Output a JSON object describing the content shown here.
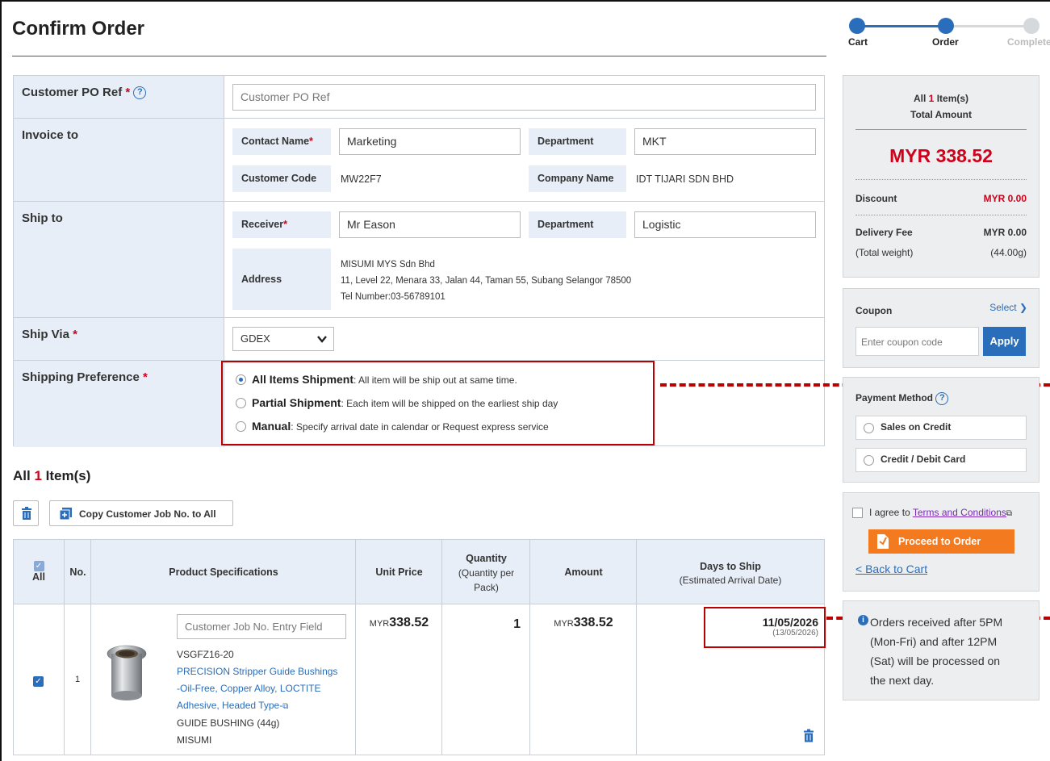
{
  "page": {
    "title": "Confirm Order"
  },
  "steps": [
    {
      "label": "Cart",
      "state": "done"
    },
    {
      "label": "Order",
      "state": "current"
    },
    {
      "label": "Complete",
      "state": "pending"
    }
  ],
  "customer_po": {
    "label": "Customer PO Ref",
    "placeholder": "Customer PO Ref"
  },
  "invoice": {
    "label": "Invoice to",
    "contact_name_label": "Contact Name",
    "contact_name_value": "Marketing",
    "department_label": "Department",
    "department_value": "MKT",
    "customer_code_label": "Customer Code",
    "customer_code_value": "MW22F7",
    "company_name_label": "Company Name",
    "company_name_value": "IDT TIJARI SDN BHD"
  },
  "ship_to": {
    "label": "Ship to",
    "receiver_label": "Receiver",
    "receiver_value": "Mr Eason",
    "department_label": "Department",
    "department_value": "Logistic",
    "address_label": "Address",
    "address_line1": "MISUMI MYS Sdn Bhd",
    "address_line2": "11, Level 22, Menara 33, Jalan 44, Taman 55, Subang Selangor   78500",
    "address_line3": "Tel Number:03-56789101"
  },
  "ship_via": {
    "label": "Ship Via",
    "selected": "GDEX"
  },
  "shipping_preference": {
    "label": "Shipping Preference",
    "options": [
      {
        "title": "All Items Shipment",
        "desc": ": All item will be ship out at same time.",
        "selected": true
      },
      {
        "title": "Partial Shipment",
        "desc": ": Each item will be shipped on the earliest ship day",
        "selected": false
      },
      {
        "title": "Manual",
        "desc": ": Specify arrival date in calendar or Request express service",
        "selected": false
      }
    ]
  },
  "items_section": {
    "title_prefix": "All",
    "count": "1",
    "title_suffix": "Item(s)",
    "copy_button": "Copy Customer Job No. to All"
  },
  "items_table": {
    "headers": {
      "all": "All",
      "no": "No.",
      "product": "Product Specifications",
      "unit_price": "Unit Price",
      "quantity": "Quantity",
      "quantity_sub": "(Quantity per Pack)",
      "amount": "Amount",
      "days_to_ship": "Days to Ship",
      "days_to_ship_sub": "(Estimated Arrival Date)"
    },
    "rows": [
      {
        "no": "1",
        "job_placeholder": "Customer Job No. Entry Field",
        "part_no": "VSGFZ16-20",
        "product_name_1": "PRECISION Stripper Guide Bushings",
        "product_name_2": "-Oil-Free, Copper Alloy, LOCTITE",
        "product_name_3": "Adhesive, Headed Type-",
        "type": "GUIDE BUSHING (44g)",
        "brand": "MISUMI",
        "currency": "MYR",
        "unit_price": "338.52",
        "quantity": "1",
        "amount": "338.52",
        "ship_date": "11/05/2026",
        "arrival_date": "(13/05/2026)"
      }
    ]
  },
  "summary": {
    "all_label": "All",
    "count": "1",
    "items_label": "Item(s)",
    "total_label": "Total Amount",
    "total": "MYR 338.52",
    "discount_label": "Discount",
    "discount": "MYR 0.00",
    "delivery_label": "Delivery Fee",
    "delivery": "MYR 0.00",
    "weight_label": "(Total weight)",
    "weight": "(44.00g)"
  },
  "coupon": {
    "label": "Coupon",
    "select": "Select",
    "placeholder": "Enter coupon code",
    "apply": "Apply"
  },
  "payment": {
    "label": "Payment Method",
    "options": [
      "Sales on Credit",
      "Credit / Debit Card"
    ]
  },
  "agree": {
    "prefix": "I agree to",
    "link": "Terms and Conditions",
    "proceed": "Proceed to Order",
    "back": "< Back to Cart"
  },
  "notice": {
    "line1": "Orders received after 5PM",
    "line2": "(Mon-Fri) and after 12PM",
    "line3": "(Sat) will be processed on",
    "line4": "the next day."
  },
  "colors": {
    "accent": "#2a6ebb",
    "price_red": "#d0021b",
    "highlight_red": "#b00000",
    "proceed_orange": "#f37a1f"
  }
}
